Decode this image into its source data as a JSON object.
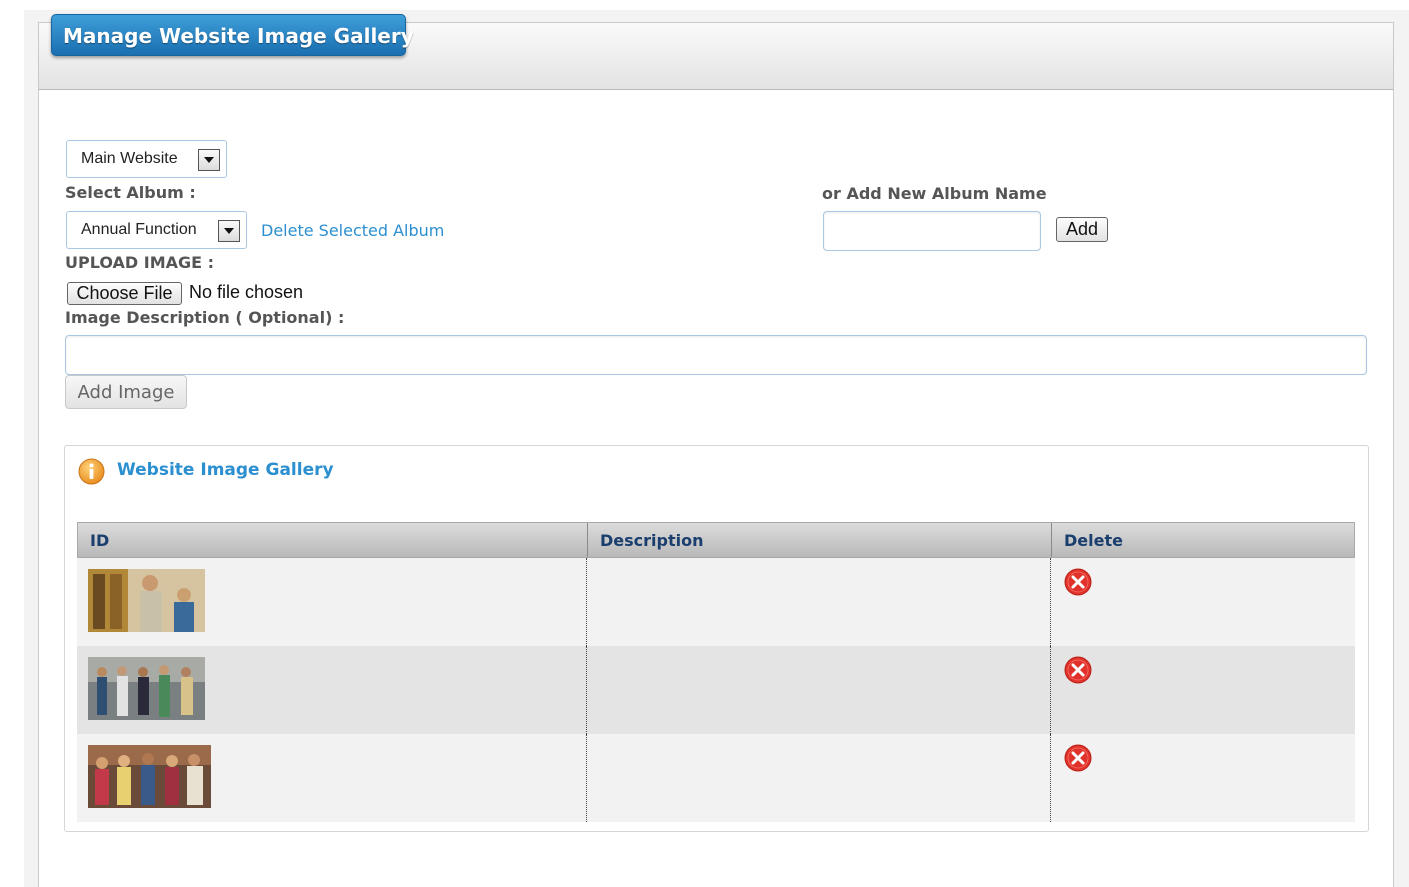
{
  "page": {
    "title": "Manage Website Image Gallery"
  },
  "form": {
    "website_select": "Main Website",
    "select_album_label": "Select Album :",
    "album_select": "Annual Function",
    "delete_album_link": "Delete Selected Album",
    "new_album_label": "or Add New Album Name",
    "new_album_value": "",
    "add_button": "Add",
    "upload_label": "UPLOAD IMAGE :",
    "choose_file_button": "Choose File",
    "file_status": "No file chosen",
    "description_label": "Image Description ( Optional) :",
    "description_value": "",
    "add_image_button": "Add Image"
  },
  "gallery": {
    "title": "Website Image Gallery",
    "columns": [
      "ID",
      "Description",
      "Delete"
    ],
    "rows": [
      {
        "description": "",
        "thumb_scene": "students-at-lockers"
      },
      {
        "description": "",
        "thumb_scene": "group-walking-hallway"
      },
      {
        "description": "",
        "thumb_scene": "students-with-books"
      }
    ]
  },
  "colors": {
    "accent": "#2b8fd0",
    "title_tab": "#1a6fb0",
    "delete_red": "#e0322a",
    "info_orange": "#f5a623"
  }
}
